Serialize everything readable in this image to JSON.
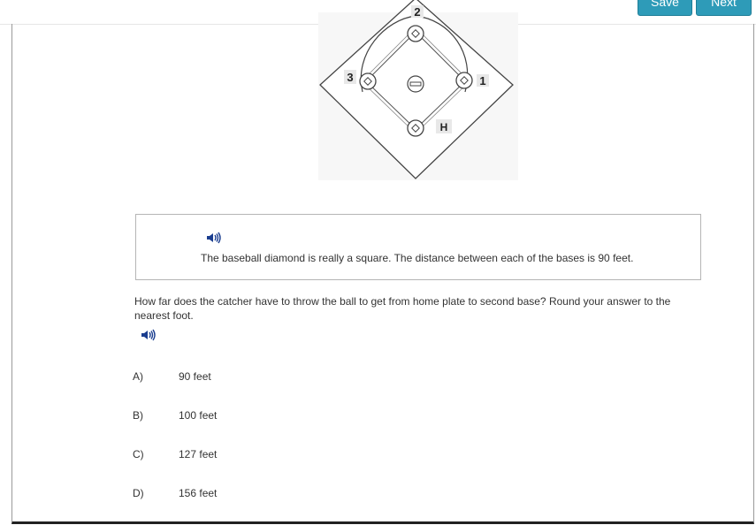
{
  "header": {
    "save_label": "Save",
    "next_label": "Next"
  },
  "diagram": {
    "base_labels": {
      "second": "2",
      "third": "3",
      "first": "1",
      "home": "H"
    }
  },
  "passage": {
    "audio_icon": "speaker-icon",
    "text": "The baseball diamond is really a square. The distance between each of the bases is 90 feet."
  },
  "question": {
    "text": "How far does the catcher have to throw the ball to get from home plate to second base? Round your answer to the nearest foot.",
    "audio_icon": "speaker-icon"
  },
  "choices": [
    {
      "letter": "A)",
      "text": "90 feet"
    },
    {
      "letter": "B)",
      "text": "100 feet"
    },
    {
      "letter": "C)",
      "text": "127 feet"
    },
    {
      "letter": "D)",
      "text": "156 feet"
    }
  ],
  "colors": {
    "button_bg": "#2e9bb8",
    "speaker": "#1a3d8f"
  }
}
